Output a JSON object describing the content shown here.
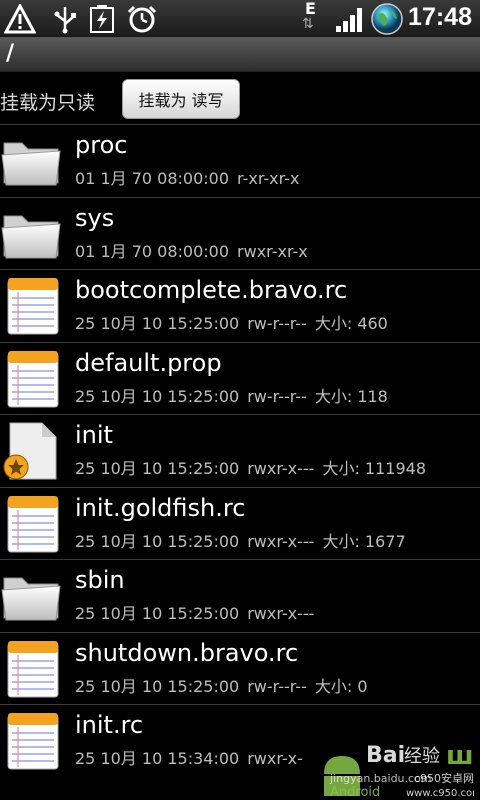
{
  "status_bar": {
    "time": "17:48",
    "network_type": "E",
    "icons": [
      "warning-icon",
      "usb-icon",
      "battery-charge-icon",
      "alarm-icon",
      "network-e-icon",
      "signal-icon",
      "globe-icon"
    ]
  },
  "path_bar": {
    "path": "/"
  },
  "mount": {
    "label": "挂载为只读",
    "button_label": "挂载为 读写"
  },
  "files": [
    {
      "name": "proc",
      "date": "01 1月 70 08:00:00",
      "perm": "r-xr-xr-x",
      "size": "",
      "icon": "folder-icon"
    },
    {
      "name": "sys",
      "date": "01 1月 70 08:00:00",
      "perm": "rwxr-xr-x",
      "size": "",
      "icon": "folder-icon"
    },
    {
      "name": "bootcomplete.bravo.rc",
      "date": "25 10月 10 15:25:00",
      "perm": "rw-r--r--",
      "size": "大小: 460",
      "icon": "notepad-icon"
    },
    {
      "name": "default.prop",
      "date": "25 10月 10 15:25:00",
      "perm": "rw-r--r--",
      "size": "大小: 118",
      "icon": "notepad-icon"
    },
    {
      "name": "init",
      "date": "25 10月 10 15:25:00",
      "perm": "rwxr-x---",
      "size": "大小: 111948",
      "icon": "executable-icon"
    },
    {
      "name": "init.goldfish.rc",
      "date": "25 10月 10 15:25:00",
      "perm": "rwxr-x---",
      "size": "大小: 1677",
      "icon": "notepad-icon"
    },
    {
      "name": "sbin",
      "date": "25 10月 10 15:25:00",
      "perm": "rwxr-x---",
      "size": "",
      "icon": "folder-icon"
    },
    {
      "name": "shutdown.bravo.rc",
      "date": "25 10月 10 15:25:00",
      "perm": "rw-r--r--",
      "size": "大小: 0",
      "icon": "notepad-icon"
    },
    {
      "name": "init.rc",
      "date": "25 10月 10 15:34:00",
      "perm": "rwxr-x-",
      "size": "",
      "icon": "notepad-icon"
    }
  ],
  "watermark": {
    "brand": "Baidu经验",
    "url": "jingyan.baidu.com",
    "site": "c950安卓网",
    "site_url": "www.c950.com",
    "android_text": "Android"
  }
}
